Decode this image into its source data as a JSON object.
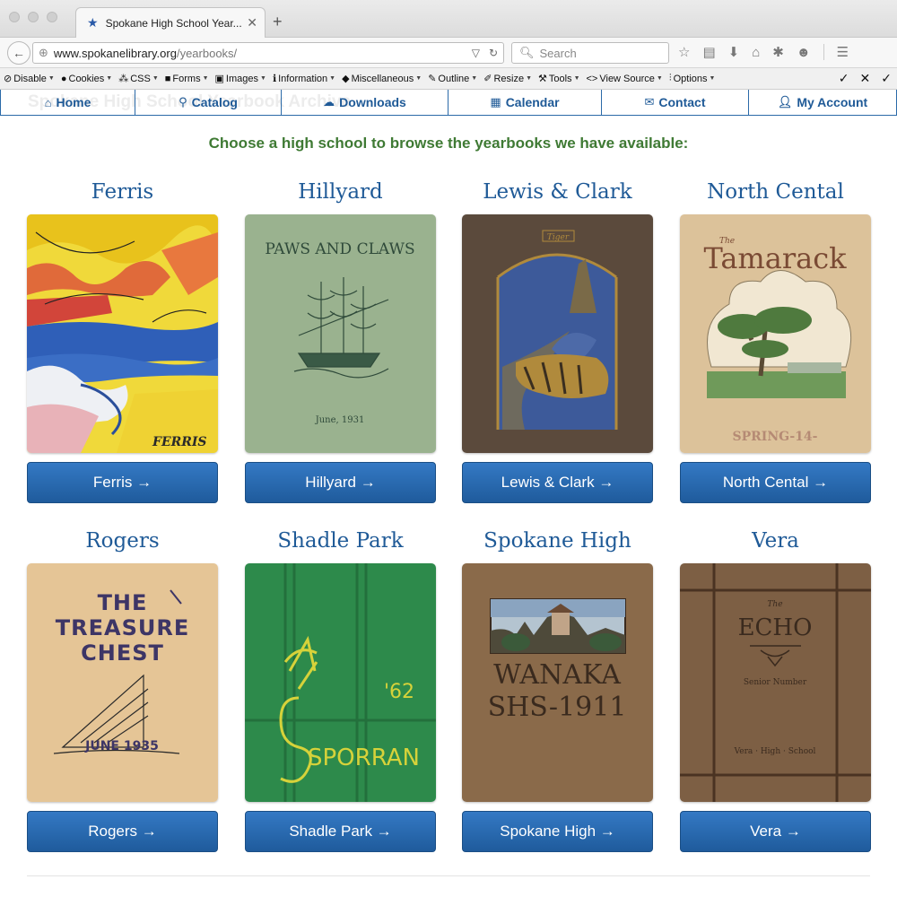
{
  "browser": {
    "tab_title": "Spokane High School Year...",
    "url_host": "www.spokanelibrary.org",
    "url_path": "/yearbooks/",
    "search_placeholder": "Search"
  },
  "devtoolbar": {
    "items": [
      "Disable",
      "Cookies",
      "CSS",
      "Forms",
      "Images",
      "Information",
      "Miscellaneous",
      "Outline",
      "Resize",
      "Tools",
      "View Source",
      "Options"
    ]
  },
  "site": {
    "ghost_title": "Spokane High School Yearbook Archive",
    "nav": [
      "Home",
      "Catalog",
      "Downloads",
      "Calendar",
      "Contact",
      "My Account"
    ],
    "intro": "Choose a high school to browse the yearbooks we have available:"
  },
  "schools": [
    {
      "name": "Ferris",
      "button": "Ferris →",
      "cover_text": "FERRIS"
    },
    {
      "name": "Hillyard",
      "button": "Hillyard →",
      "cover_text": "PAWS AND CLAWS",
      "cover_sub": "June, 1931"
    },
    {
      "name": "Lewis & Clark",
      "button": "Lewis & Clark →",
      "cover_text": "Tiger"
    },
    {
      "name": "North Cental",
      "button": "North Cental →",
      "cover_text": "Tamarack",
      "cover_pre": "The",
      "cover_sub": "SPRING-14-"
    },
    {
      "name": "Rogers",
      "button": "Rogers →",
      "cover_text": "THE TREASURE CHEST",
      "cover_sub": "JUNE 1935"
    },
    {
      "name": "Shadle Park",
      "button": "Shadle Park →",
      "cover_text": "SPORRAN",
      "cover_sub": "'62"
    },
    {
      "name": "Spokane High",
      "button": "Spokane High →",
      "cover_text": "WANAKA",
      "cover_sub": "SHS-1911"
    },
    {
      "name": "Vera",
      "button": "Vera →",
      "cover_text": "ECHO",
      "cover_pre": "The",
      "cover_sub": "Senior Number",
      "cover_foot": "Vera · High · School"
    }
  ],
  "colors": {
    "nav_blue": "#1f5a97",
    "button_blue": "#2a6bb2",
    "intro_green": "#3f7a34"
  }
}
